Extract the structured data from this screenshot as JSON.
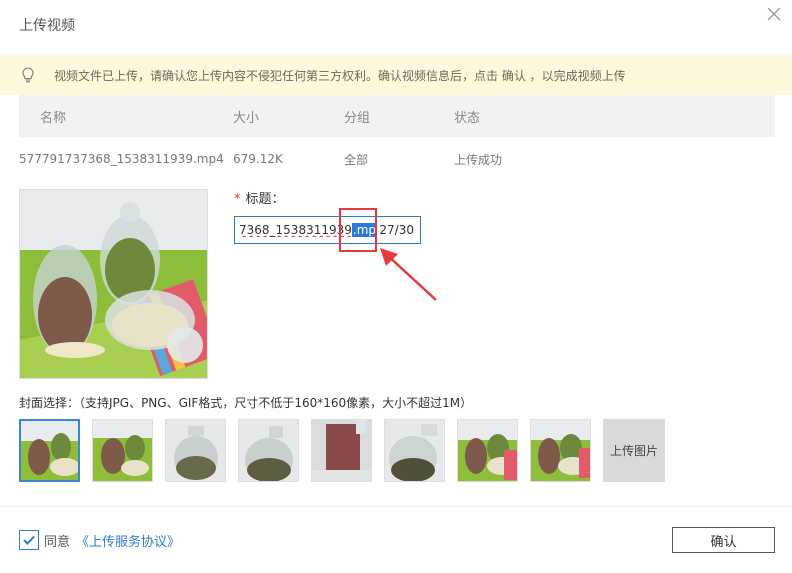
{
  "dialog": {
    "title": "上传视频"
  },
  "notice": {
    "text": "视频文件已上传，请确认您上传内容不侵犯任何第三方权利。确认视频信息后，点击 确认 ，以完成视频上传"
  },
  "table": {
    "headers": [
      "名称",
      "大小",
      "分组",
      "状态"
    ],
    "rows": [
      {
        "name": "577791737368_1538311939.mp4",
        "size": "679.12K",
        "group": "全部",
        "status": "上传成功"
      }
    ]
  },
  "form": {
    "title_label": "标题：",
    "required_mark": "*",
    "title_value_visible": "7368_1538311939",
    "title_value_selected": ".mp4",
    "char_count": "27/30"
  },
  "cover": {
    "label": "封面选择：（支持JPG、PNG、GIF格式，尺寸不低于160*160像素，大小不超过1M）",
    "thumb_count": 8,
    "selected_index": 0,
    "upload_label": "上传图片"
  },
  "footer": {
    "agree_label": "同意",
    "agreement_link": "《上传服务协议》",
    "agree_checked": true,
    "confirm_label": "确认"
  },
  "colors": {
    "accent": "#2d7bd4",
    "notice_bg": "#fbf8dc",
    "annotation_red": "#e8393a"
  }
}
